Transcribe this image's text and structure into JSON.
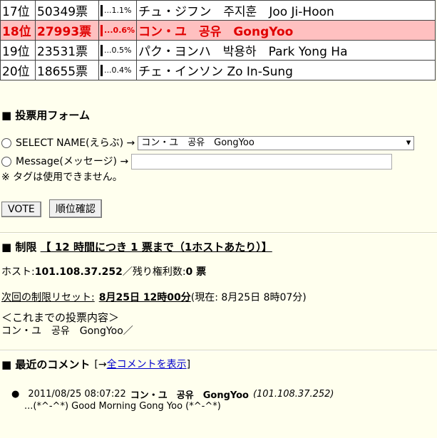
{
  "ranking": [
    {
      "rank": "17位",
      "votes": "50349票",
      "pct": "1.1%",
      "name": "チュ・ジフン　주지훈　Joo Ji-Hoon",
      "highlight": false
    },
    {
      "rank": "18位",
      "votes": "27993票",
      "pct": "0.6%",
      "name": "コン・ユ　공유　GongYoo",
      "highlight": true
    },
    {
      "rank": "19位",
      "votes": "23531票",
      "pct": "0.5%",
      "name": "パク・ヨンハ　박용하　Park Yong Ha",
      "highlight": false
    },
    {
      "rank": "20位",
      "votes": "18655票",
      "pct": "0.4%",
      "name": "チェ・インソン Zo In-Sung",
      "highlight": false
    }
  ],
  "form": {
    "title": "■ 投票用フォーム",
    "select_label": "SELECT NAME(えらぶ) →",
    "select_value": "コン・ユ　공유　GongYoo",
    "message_label": "Message(メッセージ) →",
    "message_value": "",
    "note": "※ タグは使用できません。",
    "vote_btn": "VOTE",
    "rank_btn": "順位確認"
  },
  "limit": {
    "title_prefix": "■ 制限",
    "title_link": "【 12 時間につき 1 票まで（1ホストあたり）】",
    "host_label": "ホスト:",
    "host_value": "101.108.37.252",
    "remaining_label": "／残り権利数:",
    "remaining_value": "0 票",
    "reset_label": "次回の制限リセット:",
    "reset_value": "8月25日 12時00分",
    "current": "(現在: 8月25日 8時07分)",
    "history_title": "＜これまでの投票内容＞",
    "history_value": "コン・ユ　공유　GongYoo／"
  },
  "comments": {
    "title": "■ 最近のコメント",
    "link_prefix": "[→ ",
    "link": "全コメントを表示",
    "link_suffix": "]",
    "items": [
      {
        "date": "2011/08/25 08:07:22",
        "name": "コン・ユ　공유　GongYoo",
        "ip": "(101.108.37.252)",
        "text": "...(*^-^*) Good Morning Gong Yoo (*^-^*)"
      }
    ]
  }
}
